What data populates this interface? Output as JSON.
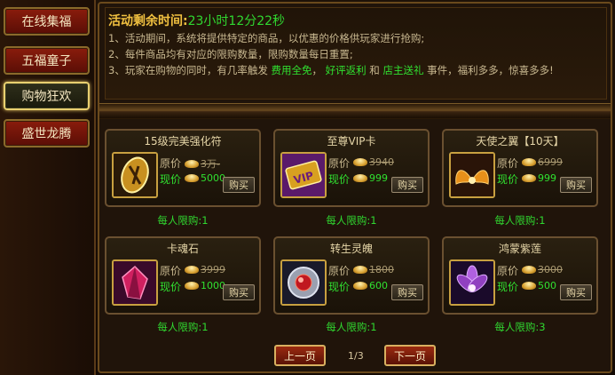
{
  "sidebar": {
    "items": [
      {
        "label": "在线集福",
        "active": false
      },
      {
        "label": "五福童子",
        "active": false
      },
      {
        "label": "购物狂欢",
        "active": true
      },
      {
        "label": "盛世龙腾",
        "active": false
      }
    ]
  },
  "notice": {
    "timer_label": "活动剩余时间:",
    "timer_value": "23小时12分22秒",
    "line1": "1、活动期间，系统将提供特定的商品，以优惠的价格供玩家进行抢购;",
    "line2": "2、每件商品均有对应的限购数量，限购数量每日重置;",
    "line3_a": "3、玩家在购物的同时，有几率触发",
    "line3_b": "费用全免",
    "line3_c": "，",
    "line3_d": "好评返利",
    "line3_e": "和",
    "line3_f": "店主送礼",
    "line3_g": "事件，福利多多，惊喜多多!"
  },
  "labels": {
    "original_price": "原价",
    "current_price": "现价",
    "buy": "购买"
  },
  "items": [
    {
      "name": "15级完美强化符",
      "original": "3万-",
      "current": "5000",
      "limit": "每人限购:1",
      "icon": "enhance-talisman-icon"
    },
    {
      "name": "至尊VIP卡",
      "original": "3940",
      "current": "999",
      "limit": "每人限购:1",
      "icon": "vip-card-icon"
    },
    {
      "name": "天使之翼【10天】",
      "original": "6999",
      "current": "999",
      "limit": "每人限购:1",
      "icon": "angel-wings-icon"
    },
    {
      "name": "卡魂石",
      "original": "3999",
      "current": "1000",
      "limit": "每人限购:1",
      "icon": "soul-stone-icon"
    },
    {
      "name": "转生灵魄",
      "original": "1800",
      "current": "600",
      "limit": "每人限购:1",
      "icon": "rebirth-spirit-icon"
    },
    {
      "name": "鸿蒙紫莲",
      "original": "3000",
      "current": "500",
      "limit": "每人限购:3",
      "icon": "purple-lotus-icon"
    }
  ],
  "pager": {
    "prev": "上一页",
    "next": "下一页",
    "page": "1/3"
  }
}
